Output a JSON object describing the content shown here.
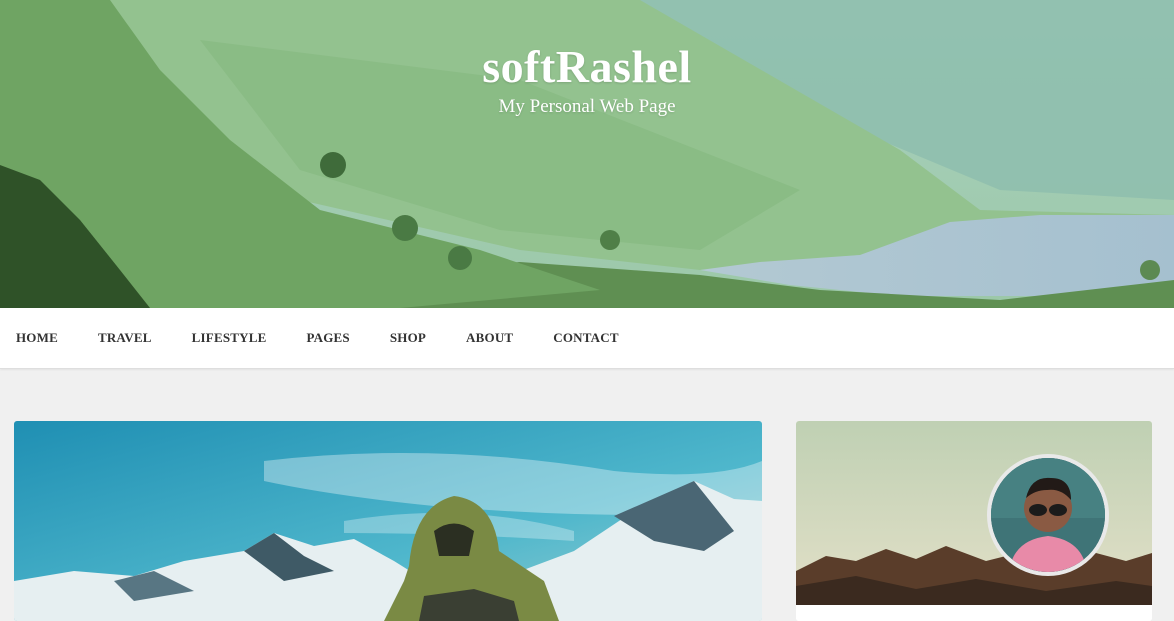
{
  "header": {
    "site_title": "softRashel",
    "tagline": "My Personal Web Page"
  },
  "nav": {
    "items": [
      {
        "label": "HOME"
      },
      {
        "label": "TRAVEL"
      },
      {
        "label": "LIFESTYLE"
      },
      {
        "label": "PAGES"
      },
      {
        "label": "SHOP"
      },
      {
        "label": "ABOUT"
      },
      {
        "label": "CONTACT"
      }
    ]
  },
  "colors": {
    "page_background": "#f0f0f0",
    "nav_background": "#ffffff",
    "nav_text": "#333333",
    "title_text": "#ffffff"
  },
  "images": {
    "hero": "mountain-valley-lake-image",
    "featured_post": "hiker-snowy-mountains-image",
    "sidebar_cover": "desert-mountains-cover-image",
    "profile": "profile-photo-avatar"
  }
}
